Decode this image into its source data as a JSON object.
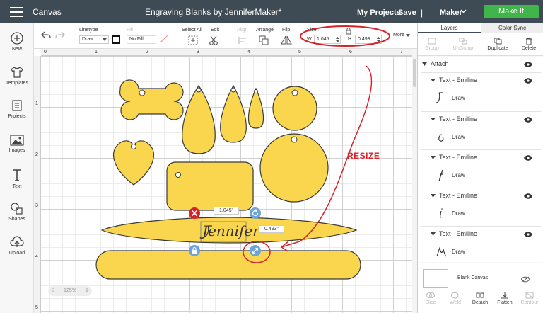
{
  "header": {
    "app_title": "Canvas",
    "project_title": "Engraving Blanks by JenniferMaker*",
    "my_projects": "My Projects",
    "save": "Save",
    "separator": "|",
    "machine": "Maker",
    "make_it": "Make It"
  },
  "sidebar": {
    "items": [
      {
        "label": "New",
        "icon": "plus-circle-icon"
      },
      {
        "label": "Templates",
        "icon": "shirt-icon"
      },
      {
        "label": "Projects",
        "icon": "projects-icon"
      },
      {
        "label": "Images",
        "icon": "image-icon"
      },
      {
        "label": "Text",
        "icon": "text-icon"
      },
      {
        "label": "Shapes",
        "icon": "shapes-icon"
      },
      {
        "label": "Upload",
        "icon": "upload-icon"
      }
    ]
  },
  "toolbar": {
    "linetype_label": "Linetype",
    "linetype_value": "Draw",
    "fill_label": "Fill",
    "fill_value": "No Fill",
    "select_all": "Select All",
    "edit": "Edit",
    "align": "Align",
    "arrange": "Arrange",
    "flip": "Flip",
    "size_label": "Size",
    "w_label": "W",
    "w_value": "1.045",
    "h_label": "H",
    "h_value": "0.493",
    "more": "More"
  },
  "rulers": {
    "top": [
      "0",
      "1",
      "2",
      "3",
      "4",
      "5",
      "6",
      "7"
    ],
    "left": [
      "1",
      "2",
      "3",
      "4",
      "5"
    ]
  },
  "canvas": {
    "width_badge": "1.045\"",
    "height_badge": "0.493\"",
    "selected_text": "Jennifer",
    "zoom": "125%",
    "annotation": "RESIZE"
  },
  "layers_panel": {
    "tab_layers": "Layers",
    "tab_color_sync": "Color Sync",
    "tools": {
      "group": "Group",
      "ungroup": "UnGroup",
      "duplicate": "Duplicate",
      "delete": "Delete"
    },
    "attach": "Attach",
    "items": [
      {
        "name": "Text - Emiline",
        "type": "Draw"
      },
      {
        "name": "Text - Emiline",
        "type": "Draw"
      },
      {
        "name": "Text - Emiline",
        "type": "Draw"
      },
      {
        "name": "Text - Emiline",
        "type": "Draw"
      },
      {
        "name": "Text - Emiline",
        "type": "Draw"
      }
    ],
    "blank_canvas": "Blank Canvas",
    "bottom_tools": {
      "slice": "Slice",
      "weld": "Weld",
      "detach": "Detach",
      "flatten": "Flatten",
      "contour": "Contour"
    }
  },
  "colors": {
    "header_bg": "#3e4a54",
    "make_it": "#3fb54a",
    "shape_fill": "#f9d64e",
    "annotation_red": "#d6232a",
    "handle_blue": "#6fa3d8"
  }
}
